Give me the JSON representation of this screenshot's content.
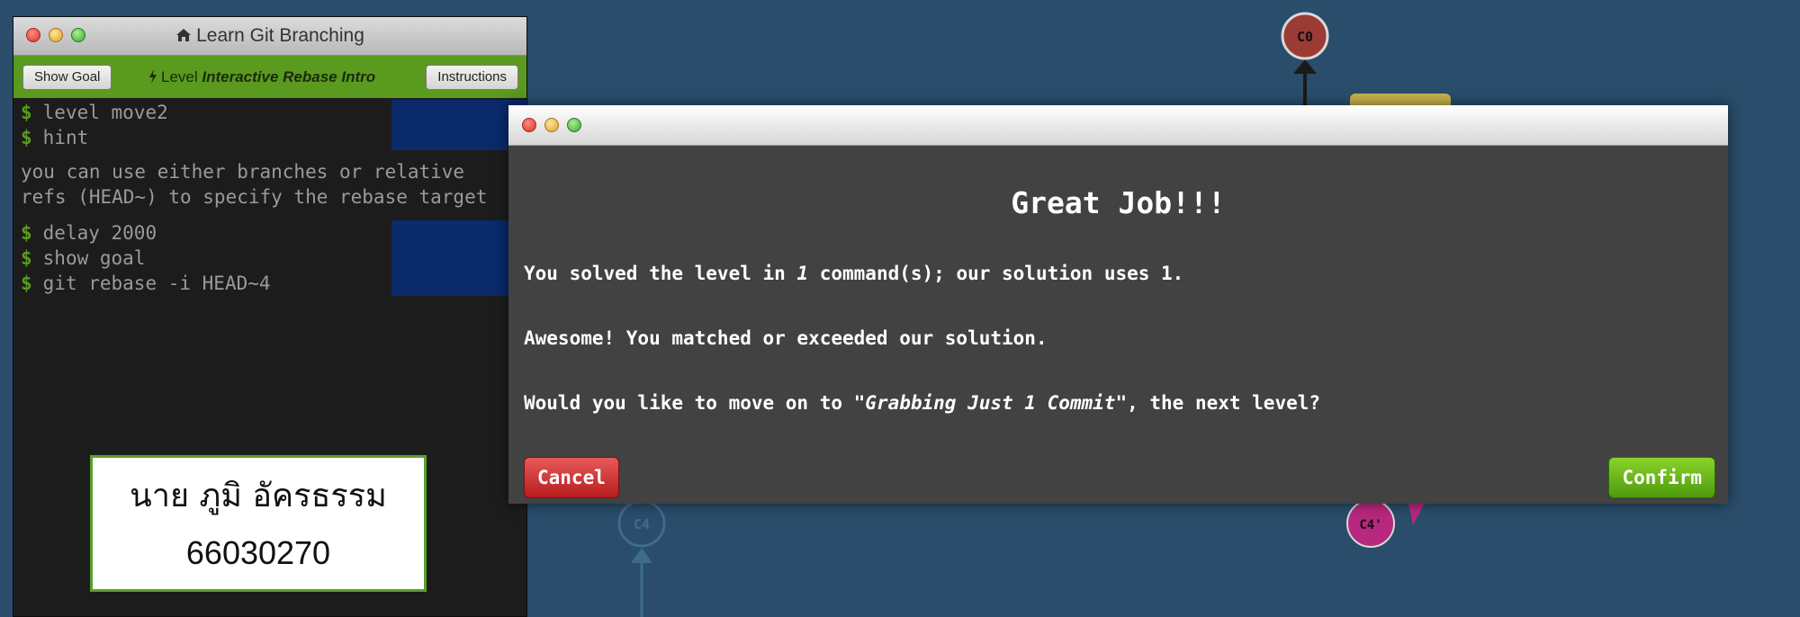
{
  "terminal": {
    "title": "Learn Git Branching",
    "show_goal_label": "Show Goal",
    "level_prefix": "Level",
    "level_name": "Interactive Rebase Intro",
    "instructions_label": "Instructions",
    "commands_top": [
      {
        "prompt": "$",
        "text": "level move2"
      },
      {
        "prompt": "$",
        "text": "hint"
      }
    ],
    "hint_lines": "you can use either branches or relative\nrefs (HEAD~) to specify the rebase target",
    "commands_bottom": [
      {
        "prompt": "$",
        "text": "delay 2000"
      },
      {
        "prompt": "$",
        "text": "show goal"
      },
      {
        "prompt": "$",
        "text": "git rebase -i HEAD~4"
      }
    ]
  },
  "name_card": {
    "name": "นาย ภูมิ อัครธรรม",
    "id": "66030270"
  },
  "graph": {
    "nodes": [
      "C0",
      "C4",
      "C4'"
    ],
    "colors": {
      "c0": "#9c3b33",
      "c4prime": "#b8287e",
      "c4": "#2a4d6b"
    }
  },
  "modal": {
    "heading": "Great Job!!!",
    "p1_prefix": "You solved the level in ",
    "p1_count": "1",
    "p1_suffix": " command(s); our solution uses 1.",
    "p2": "Awesome! You matched or exceeded our solution.",
    "p3_prefix": "Would you like to move on to ",
    "p3_level": "\"Grabbing Just 1 Commit\"",
    "p3_suffix": ", the next level?",
    "cancel_label": "Cancel",
    "confirm_label": "Confirm"
  }
}
